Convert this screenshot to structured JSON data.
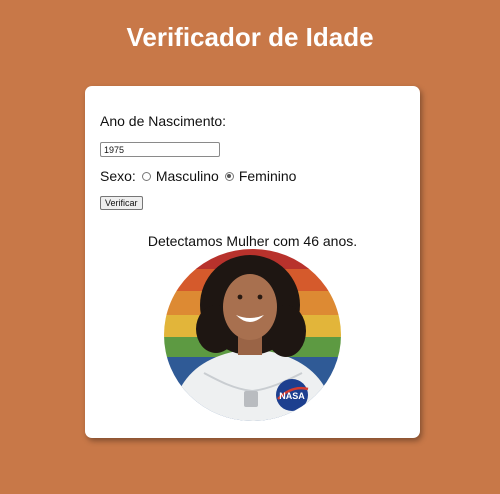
{
  "header": {
    "title": "Verificador de Idade"
  },
  "form": {
    "year_label": "Ano de Nascimento:",
    "year_value": "1975",
    "sex_label": "Sexo:",
    "options": [
      {
        "label": "Masculino",
        "checked": false
      },
      {
        "label": "Feminino",
        "checked": true
      }
    ],
    "submit_label": "Verificar"
  },
  "result": {
    "text": "Detectamos Mulher com 46 anos.",
    "badge_text": "NASA"
  },
  "colors": {
    "background": "#c87848",
    "card": "#ffffff",
    "title": "#ffffff"
  }
}
